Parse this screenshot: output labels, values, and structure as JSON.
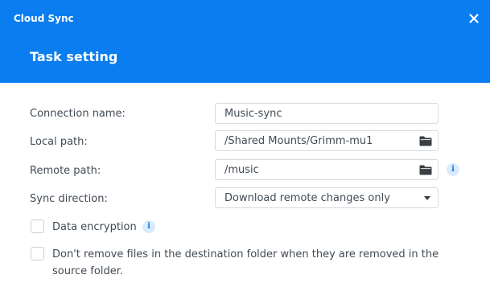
{
  "window": {
    "app_title": "Cloud Sync",
    "dialog_title": "Task setting",
    "close_icon": "close-icon",
    "accent_color": "#0a7df0"
  },
  "form": {
    "connection_name": {
      "label": "Connection name:",
      "value": "Music-sync"
    },
    "local_path": {
      "label": "Local path:",
      "value": "/Shared Mounts/Grimm-mu1",
      "icon": "folder-icon"
    },
    "remote_path": {
      "label": "Remote path:",
      "value": "/music",
      "icon": "folder-icon",
      "info_icon": "info-icon"
    },
    "sync_direction": {
      "label": "Sync direction:",
      "selected": "Download remote changes only",
      "icon": "chevron-down-icon"
    },
    "data_encryption": {
      "label": "Data encryption",
      "checked": false,
      "info_icon": "info-icon"
    },
    "keep_files": {
      "label": "Don't remove files in the destination folder when they are removed in the source folder.",
      "checked": false
    }
  }
}
